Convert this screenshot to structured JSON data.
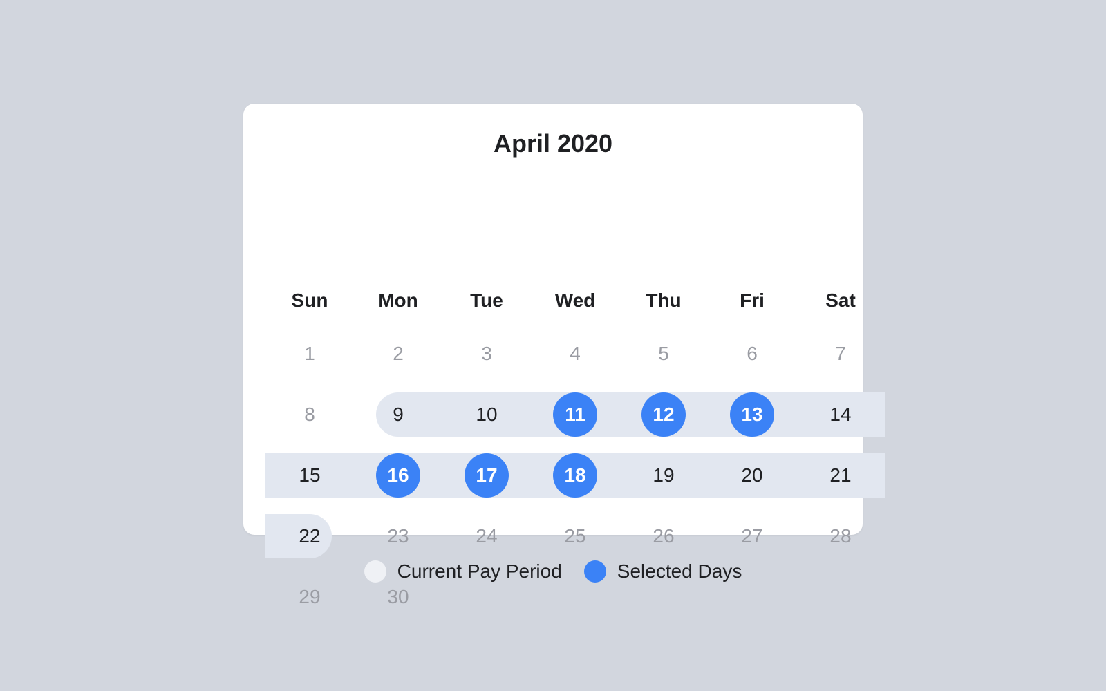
{
  "calendar": {
    "title": "April 2020",
    "weekdays": [
      "Sun",
      "Mon",
      "Tue",
      "Wed",
      "Thu",
      "Fri",
      "Sat"
    ],
    "start_weekday": 0,
    "days_in_month": 30,
    "pay_period": [
      9,
      10,
      11,
      12,
      13,
      14,
      15,
      16,
      17,
      18,
      19,
      20,
      21,
      22
    ],
    "selected_days": [
      11,
      12,
      13,
      16,
      17,
      18
    ]
  },
  "legend": {
    "items": [
      {
        "label": "Current Pay Period",
        "color": "#eff1f5"
      },
      {
        "label": "Selected Days",
        "color": "#3b82f6"
      }
    ]
  },
  "colors": {
    "background": "#d2d6de",
    "card": "#ffffff",
    "band": "#e2e7f0",
    "selected": "#3b82f6",
    "muted_text": "#9a9ca3",
    "text": "#1f2023"
  }
}
